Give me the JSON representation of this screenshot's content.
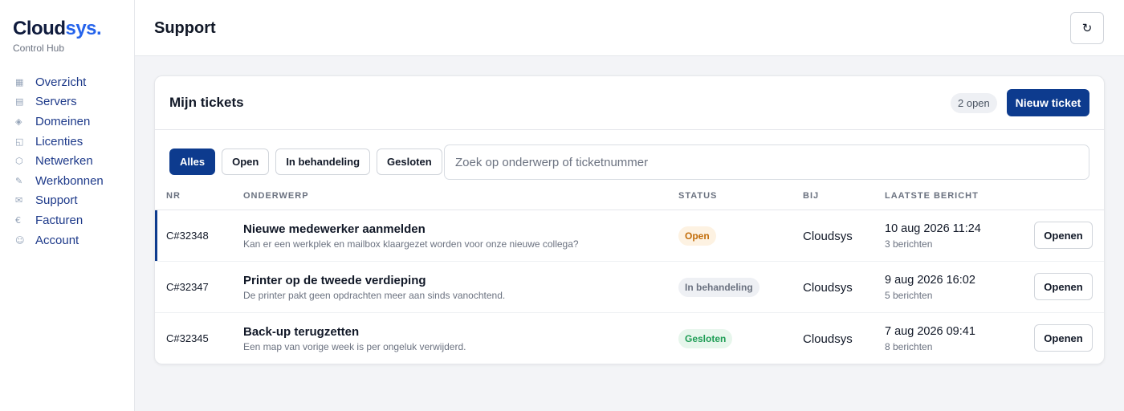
{
  "brand": {
    "name_main": "Cloud",
    "name_accent": "sys.",
    "subtitle": "Control Hub"
  },
  "sidebar": {
    "items": [
      {
        "label": "Overzicht",
        "icon": "grid-icon",
        "glyph": "▦"
      },
      {
        "label": "Servers",
        "icon": "server-icon",
        "glyph": "▤"
      },
      {
        "label": "Domeinen",
        "icon": "diamond-icon",
        "glyph": "◈"
      },
      {
        "label": "Licenties",
        "icon": "license-icon",
        "glyph": "◱"
      },
      {
        "label": "Netwerken",
        "icon": "network-icon",
        "glyph": "⬡"
      },
      {
        "label": "Werkbonnen",
        "icon": "wrench-icon",
        "glyph": "✎"
      },
      {
        "label": "Support",
        "icon": "mail-icon",
        "glyph": "✉"
      },
      {
        "label": "Facturen",
        "icon": "euro-icon",
        "glyph": "€"
      },
      {
        "label": "Account",
        "icon": "user-icon",
        "glyph": "☺"
      }
    ]
  },
  "header": {
    "title": "Support",
    "refresh_icon": "↻"
  },
  "card": {
    "title": "Mijn tickets",
    "count_badge": "2 open",
    "new_button": "Nieuw ticket",
    "filters": [
      {
        "label": "Alles",
        "active": true
      },
      {
        "label": "Open",
        "active": false
      },
      {
        "label": "In behandeling",
        "active": false
      },
      {
        "label": "Gesloten",
        "active": false
      }
    ],
    "search_placeholder": "Zoek op onderwerp of ticketnummer",
    "columns": {
      "nr": "NR",
      "subject": "ONDERWERP",
      "status": "STATUS",
      "bij": "BIJ",
      "last": "LAATSTE BERICHT"
    },
    "rows": [
      {
        "nr": "C#32348",
        "subject": "Nieuwe medewerker aanmelden",
        "description": "Kan er een werkplek en mailbox klaargezet worden voor onze nieuwe collega?",
        "status": "Open",
        "bij": "Cloudsys",
        "last_date": "10 aug 2026 11:24",
        "messages": "3 berichten",
        "action": "Openen"
      },
      {
        "nr": "C#32347",
        "subject": "Printer op de tweede verdieping",
        "description": "De printer pakt geen opdrachten meer aan sinds vanochtend.",
        "status": "In behandeling",
        "bij": "Cloudsys",
        "last_date": "9 aug 2026 16:02",
        "messages": "5 berichten",
        "action": "Openen"
      },
      {
        "nr": "C#32345",
        "subject": "Back-up terugzetten",
        "description": "Een map van vorige week is per ongeluk verwijderd.",
        "status": "Gesloten",
        "bij": "Cloudsys",
        "last_date": "7 aug 2026 09:41",
        "messages": "8 berichten",
        "action": "Openen"
      }
    ]
  }
}
